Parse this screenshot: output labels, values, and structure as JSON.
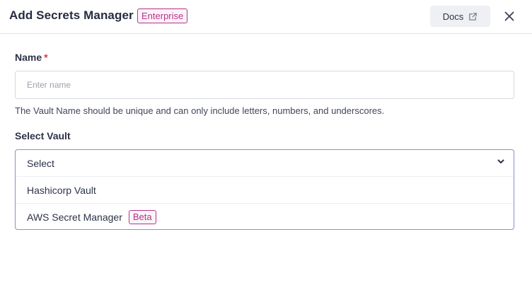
{
  "header": {
    "title": "Add Secrets Manager",
    "badge": "Enterprise",
    "docs_label": "Docs"
  },
  "form": {
    "name": {
      "label": "Name",
      "required_mark": "*",
      "placeholder": "Enter name",
      "value": "",
      "help": "The Vault Name should be unique and can only include letters, numbers, and underscores."
    },
    "vault": {
      "label": "Select Vault",
      "selected": "Select",
      "options": [
        {
          "label": "Hashicorp Vault"
        },
        {
          "label": "AWS Secret Manager",
          "badge": "Beta"
        }
      ]
    }
  },
  "colors": {
    "accent_badge": "#b5338a",
    "dropdown_border": "#8b8fc9",
    "required": "#d9394f"
  }
}
